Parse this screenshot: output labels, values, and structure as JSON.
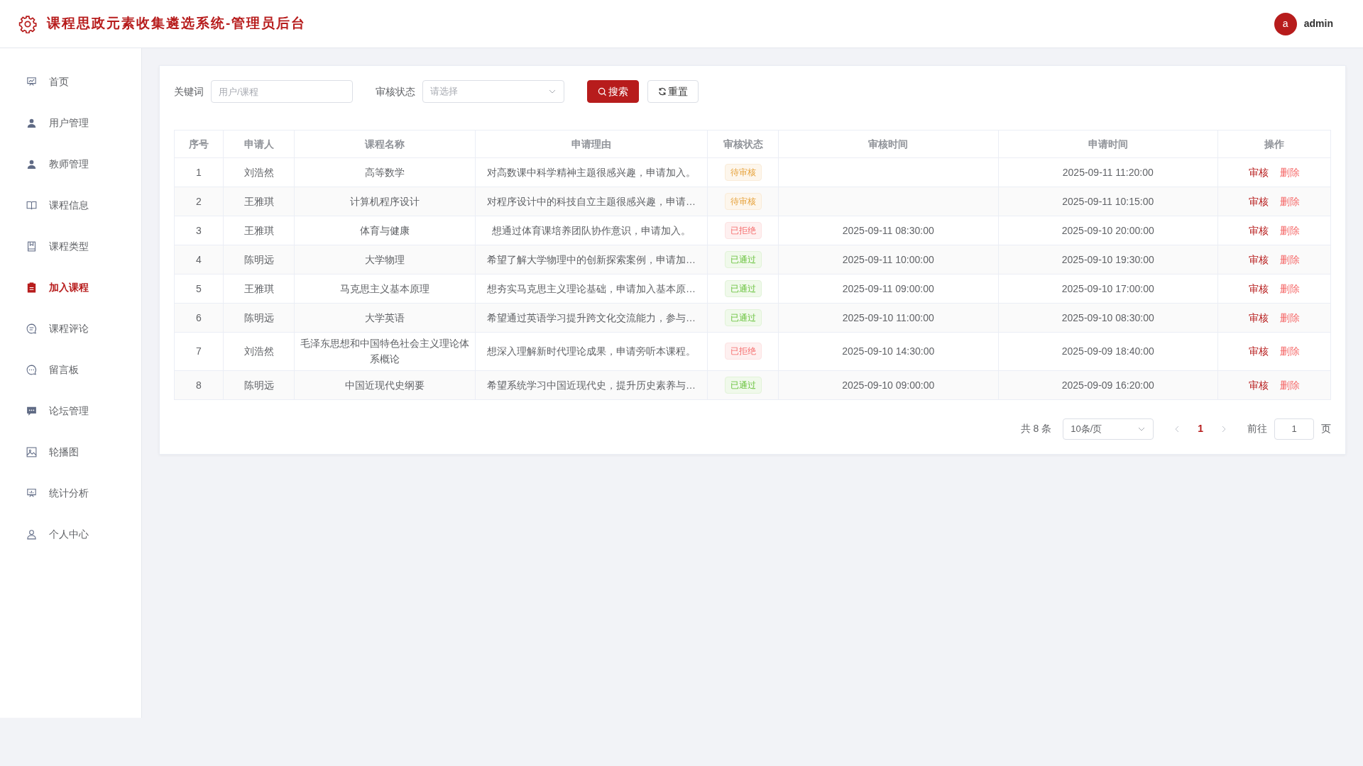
{
  "header": {
    "title": "课程思政元素收集遴选系统-管理员后台",
    "user": {
      "initial": "a",
      "name": "admin"
    }
  },
  "sidebar": {
    "items": [
      {
        "label": "首页",
        "selected": false
      },
      {
        "label": "用户管理",
        "selected": false
      },
      {
        "label": "教师管理",
        "selected": false
      },
      {
        "label": "课程信息",
        "selected": false
      },
      {
        "label": "课程类型",
        "selected": false
      },
      {
        "label": "加入课程",
        "selected": true
      },
      {
        "label": "课程评论",
        "selected": false
      },
      {
        "label": "留言板",
        "selected": false
      },
      {
        "label": "论坛管理",
        "selected": false
      },
      {
        "label": "轮播图",
        "selected": false
      },
      {
        "label": "统计分析",
        "selected": false
      },
      {
        "label": "个人中心",
        "selected": false
      }
    ]
  },
  "filters": {
    "keyword": {
      "label": "关键词",
      "placeholder": "用户/课程"
    },
    "status": {
      "label": "审核状态",
      "placeholder": "请选择"
    },
    "buttons": [
      {
        "label": "搜索",
        "kind": "primary"
      },
      {
        "label": "重置",
        "kind": "plain"
      }
    ]
  },
  "table": {
    "columns": [
      "序号",
      "申请人",
      "课程名称",
      "申请理由",
      "审核状态",
      "审核时间",
      "申请时间",
      "操作"
    ],
    "rows": [
      {
        "no": "1",
        "applicant": "刘浩然",
        "course": "高等数学",
        "reason": "对高数课中科学精神主题很感兴趣，申请加入。",
        "status": {
          "text": "待审核",
          "kind": "pending"
        },
        "review_time": "",
        "apply_time": "2025-09-11 11:20:00",
        "actions": [
          "审核",
          "删除"
        ]
      },
      {
        "no": "2",
        "applicant": "王雅琪",
        "course": "计算机程序设计",
        "reason": "对程序设计中的科技自立主题很感兴趣，申请…",
        "status": {
          "text": "待审核",
          "kind": "pending"
        },
        "review_time": "",
        "apply_time": "2025-09-11 10:15:00",
        "actions": [
          "审核",
          "删除"
        ]
      },
      {
        "no": "3",
        "applicant": "王雅琪",
        "course": "体育与健康",
        "reason": "想通过体育课培养团队协作意识，申请加入。",
        "status": {
          "text": "已拒绝",
          "kind": "rejected"
        },
        "review_time": "2025-09-11 08:30:00",
        "apply_time": "2025-09-10 20:00:00",
        "actions": [
          "审核",
          "删除"
        ]
      },
      {
        "no": "4",
        "applicant": "陈明远",
        "course": "大学物理",
        "reason": "希望了解大学物理中的创新探索案例，申请加…",
        "status": {
          "text": "已通过",
          "kind": "approved"
        },
        "review_time": "2025-09-11 10:00:00",
        "apply_time": "2025-09-10 19:30:00",
        "actions": [
          "审核",
          "删除"
        ]
      },
      {
        "no": "5",
        "applicant": "王雅琪",
        "course": "马克思主义基本原理",
        "reason": "想夯实马克思主义理论基础，申请加入基本原…",
        "status": {
          "text": "已通过",
          "kind": "approved"
        },
        "review_time": "2025-09-11 09:00:00",
        "apply_time": "2025-09-10 17:00:00",
        "actions": [
          "审核",
          "删除"
        ]
      },
      {
        "no": "6",
        "applicant": "陈明远",
        "course": "大学英语",
        "reason": "希望通过英语学习提升跨文化交流能力，参与…",
        "status": {
          "text": "已通过",
          "kind": "approved"
        },
        "review_time": "2025-09-10 11:00:00",
        "apply_time": "2025-09-10 08:30:00",
        "actions": [
          "审核",
          "删除"
        ]
      },
      {
        "no": "7",
        "applicant": "刘浩然",
        "course": "毛泽东思想和中国特色社会主义理论体系概论",
        "reason": "想深入理解新时代理论成果，申请旁听本课程。",
        "status": {
          "text": "已拒绝",
          "kind": "rejected"
        },
        "review_time": "2025-09-10 14:30:00",
        "apply_time": "2025-09-09 18:40:00",
        "actions": [
          "审核",
          "删除"
        ]
      },
      {
        "no": "8",
        "applicant": "陈明远",
        "course": "中国近现代史纲要",
        "reason": "希望系统学习中国近现代史，提升历史素养与…",
        "status": {
          "text": "已通过",
          "kind": "approved"
        },
        "review_time": "2025-09-10 09:00:00",
        "apply_time": "2025-09-09 16:20:00",
        "actions": [
          "审核",
          "删除"
        ]
      }
    ]
  },
  "pagination": {
    "total": "共 8 条",
    "page_size": "10条/页",
    "pages": [
      {
        "label": "1",
        "selected": true
      }
    ],
    "goto_label": "前往",
    "goto_value": "1",
    "goto_suffix": "页"
  }
}
